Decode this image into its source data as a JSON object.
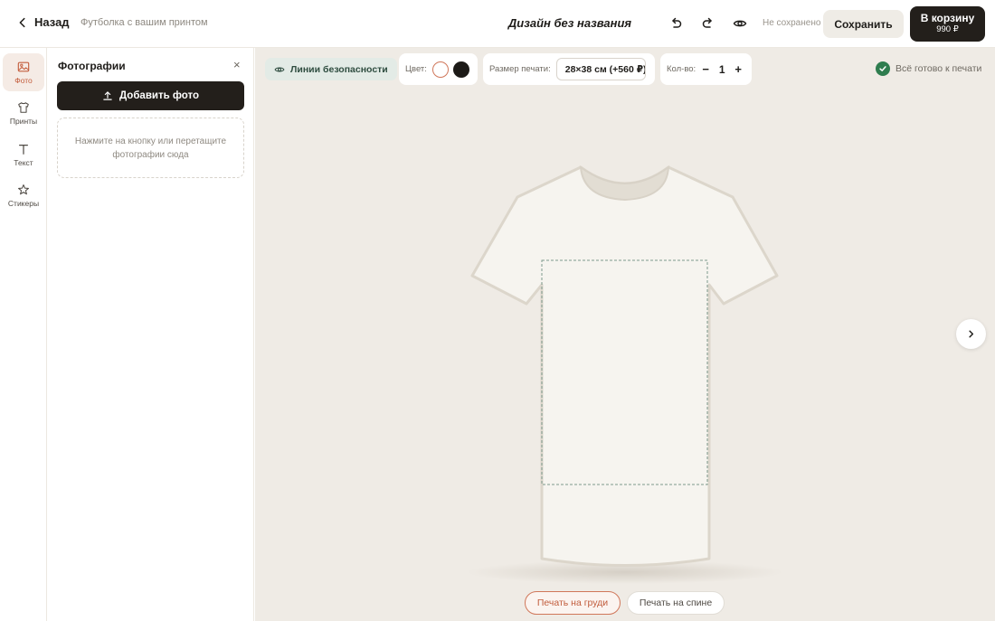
{
  "header": {
    "back_label": "Назад",
    "subtitle": "Футболка с вашим принтом",
    "title": "Дизайн без названия",
    "undo_icon": "undo-icon",
    "redo_icon": "redo-icon",
    "preview_icon": "eye-icon",
    "status": "Не сохранено",
    "save_label": "Сохранить",
    "cart_label": "В корзину",
    "cart_price": "990 ₽"
  },
  "rail": {
    "items": [
      {
        "label": "Фото",
        "icon": "image-icon",
        "active": true
      },
      {
        "label": "Принты",
        "icon": "tshirt-icon",
        "active": false
      },
      {
        "label": "Текст",
        "icon": "text-icon",
        "active": false
      },
      {
        "label": "Стикеры",
        "icon": "star-icon",
        "active": false
      }
    ]
  },
  "panel": {
    "title": "Фотографии",
    "close_glyph": "×",
    "add_label": "Добавить фото",
    "dropzone_text": "Нажмите на кнопку или перетащите фотографии сюда"
  },
  "toolbar": {
    "safety_label": "Линии безопасности",
    "color_label": "Цвет:",
    "colors": [
      {
        "name": "white",
        "hex": "#ffffff",
        "selected": true
      },
      {
        "name": "black",
        "hex": "#1c1a17",
        "selected": false
      }
    ],
    "size_label": "Размер печати:",
    "size_value": "28×38 см (+560 ₽)",
    "qty_label": "Кол-во:",
    "qty_minus": "−",
    "qty_value": "1",
    "qty_plus": "+",
    "ready_label": "Всё готово к печати"
  },
  "sides": {
    "front_label": "Печать на груди",
    "back_label": "Печать на спине",
    "active": "front"
  },
  "colors": {
    "accent": "#c45f3f",
    "dark": "#231f1b",
    "success": "#2f7d4f",
    "canvas_bg": "#efebe5"
  }
}
